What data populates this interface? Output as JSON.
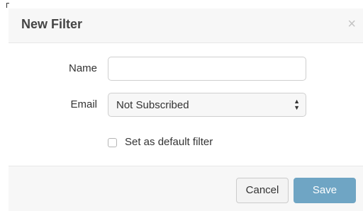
{
  "dialog": {
    "title": "New Filter",
    "close_symbol": "×"
  },
  "form": {
    "name": {
      "label": "Name",
      "value": "",
      "placeholder": ""
    },
    "email": {
      "label": "Email",
      "selected": "Not Subscribed"
    },
    "default_filter": {
      "label": "Set as default filter",
      "checked": false
    }
  },
  "footer": {
    "cancel_label": "Cancel",
    "save_label": "Save"
  },
  "colors": {
    "save_button": "#6fa5c4",
    "header_background": "#f7f7f7",
    "footer_background": "#f7f7f7"
  },
  "icons": {
    "close": "close-icon",
    "select_arrows": "up-down-arrows-icon"
  }
}
